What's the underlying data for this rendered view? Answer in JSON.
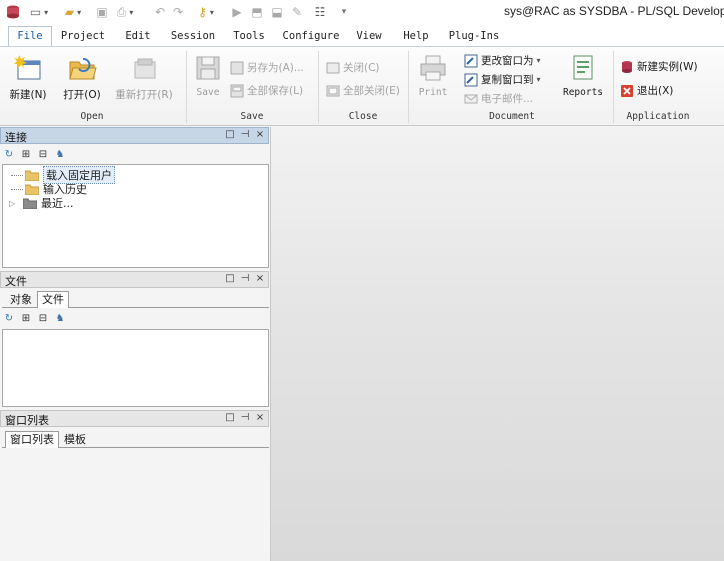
{
  "window": {
    "title": "sys@RAC as SYSDBA - PL/SQL Developer"
  },
  "quick_access": {
    "icons": [
      "app-icon",
      "new-icon",
      "open-icon",
      "save-icon",
      "print-icon",
      "undo-icon",
      "redo-icon",
      "key-icon",
      "run-icon",
      "lock-icon",
      "unlock-icon",
      "pin-icon",
      "settings-icon",
      "customize-icon"
    ]
  },
  "ribbon_tabs": [
    "File",
    "Project",
    "Edit",
    "Session",
    "Tools",
    "Configure",
    "View",
    "Help",
    "Plug-Ins"
  ],
  "ribbon": {
    "open": {
      "label": "Open",
      "new": "新建(N)",
      "open": "打开(O)",
      "reopen": "重新打开(R)"
    },
    "save": {
      "label": "Save",
      "save": "Save",
      "save_as": "另存为(A)...",
      "save_all": "全部保存(L)"
    },
    "close": {
      "label": "Close",
      "close": "关闭(C)",
      "close_all": "全部关闭(E)"
    },
    "document": {
      "label": "Document",
      "print": "Print",
      "change_window": "更改窗口为",
      "copy_window": "复制窗口到",
      "email": "电子邮件...",
      "reports": "Reports"
    },
    "application": {
      "label": "Application",
      "new_instance": "新建实例(W)",
      "exit": "退出(X)"
    }
  },
  "connection_panel": {
    "title": "连接",
    "tree": [
      "载入固定用户",
      "输入历史",
      "最近..."
    ]
  },
  "file_panel": {
    "title": "文件",
    "tabs": [
      "对象",
      "文件"
    ]
  },
  "window_list_panel": {
    "title": "窗口列表",
    "tabs": [
      "窗口列表",
      "模板"
    ]
  },
  "panel_controls": {
    "float": "□",
    "pin": "⊣",
    "close": "×"
  },
  "colors": {
    "accent": "#1b5ea8",
    "active_panel_header": "#c7d6e7",
    "workspace": "#e4e4e4"
  }
}
